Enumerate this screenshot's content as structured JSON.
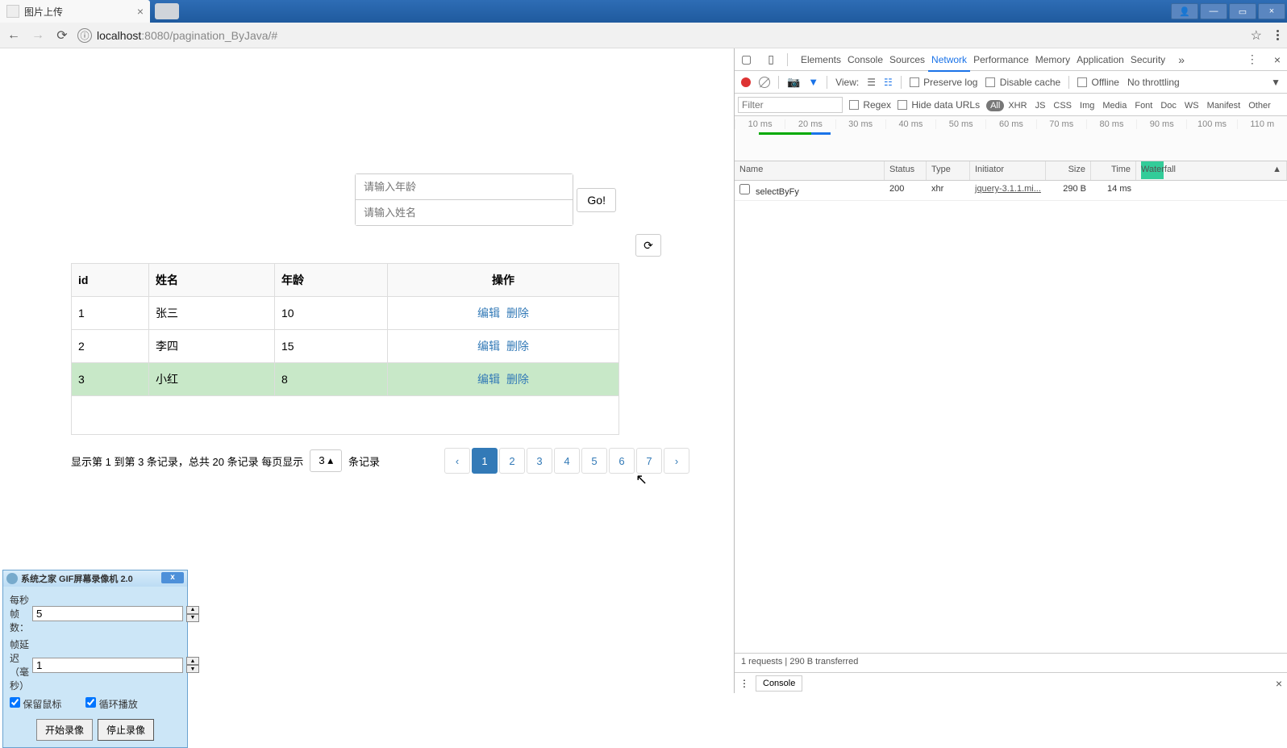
{
  "browser": {
    "tab_title": "图片上传",
    "url_host": "localhost",
    "url_port": ":8080",
    "url_path": "/pagination_ByJava/#"
  },
  "app": {
    "age_placeholder": "请输入年龄",
    "name_placeholder": "请输入姓名",
    "go_label": "Go!",
    "table": {
      "headers": [
        "id",
        "姓名",
        "年龄",
        "操作"
      ],
      "rows": [
        {
          "id": "1",
          "name": "张三",
          "age": "10"
        },
        {
          "id": "2",
          "name": "李四",
          "age": "15"
        },
        {
          "id": "3",
          "name": "小红",
          "age": "8",
          "highlight": true
        }
      ],
      "edit": "编辑",
      "delete": "删除"
    },
    "pager": {
      "info": "显示第 1 到第 3 条记录，总共 20 条记录 每页显示",
      "size": "3 ▴",
      "suffix": "条记录",
      "prev": "‹",
      "pages": [
        "1",
        "2",
        "3",
        "4",
        "5",
        "6",
        "7"
      ],
      "next": "›",
      "active": "1"
    }
  },
  "devtools": {
    "tabs": [
      "Elements",
      "Console",
      "Sources",
      "Network",
      "Performance",
      "Memory",
      "Application",
      "Security"
    ],
    "active_tab": "Network",
    "view_label": "View:",
    "preserve": "Preserve log",
    "disable_cache": "Disable cache",
    "offline": "Offline",
    "throttling": "No throttling",
    "filter_placeholder": "Filter",
    "regex": "Regex",
    "hide_urls": "Hide data URLs",
    "types": [
      "All",
      "XHR",
      "JS",
      "CSS",
      "Img",
      "Media",
      "Font",
      "Doc",
      "WS",
      "Manifest",
      "Other"
    ],
    "timeline_ticks": [
      "10 ms",
      "20 ms",
      "30 ms",
      "40 ms",
      "50 ms",
      "60 ms",
      "70 ms",
      "80 ms",
      "90 ms",
      "100 ms",
      "110 m"
    ],
    "columns": [
      "Name",
      "Status",
      "Type",
      "Initiator",
      "Size",
      "Time",
      "Waterfall"
    ],
    "requests": [
      {
        "name": "selectByFy",
        "status": "200",
        "type": "xhr",
        "initiator": "jquery-3.1.1.mi...",
        "size": "290 B",
        "time": "14 ms"
      }
    ],
    "status": "1 requests  |  290 B transferred",
    "drawer_tab": "Console"
  },
  "popup": {
    "title": "系统之家  GIF屏幕录像机  2.0",
    "fps_label": "每秒帧数：",
    "fps_value": "5",
    "delay_label": "帧延迟（毫秒）",
    "delay_value": "1",
    "keep_mouse": "保留鼠标",
    "loop": "循环播放",
    "start": "开始录像",
    "stop": "停止录像"
  }
}
